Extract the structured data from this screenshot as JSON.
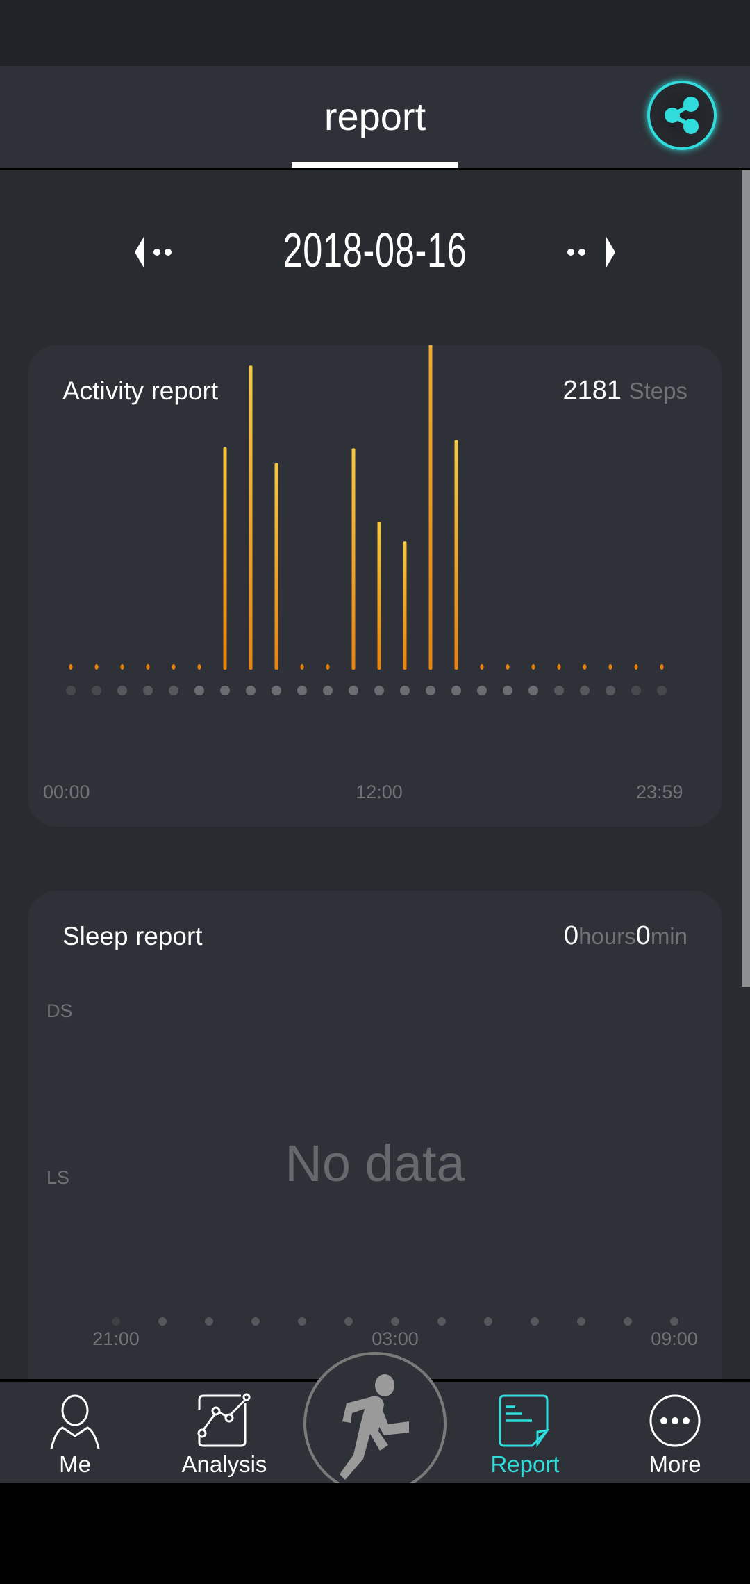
{
  "header": {
    "title": "report",
    "share_icon": "share-icon"
  },
  "date_nav": {
    "date": "2018-08-16",
    "prev_icon": "arrow-left-icon",
    "next_icon": "arrow-right-icon"
  },
  "activity": {
    "title": "Activity report",
    "steps": "2181",
    "steps_unit": "Steps",
    "x_labels": [
      "00:00",
      "12:00",
      "23:59"
    ]
  },
  "sleep": {
    "title": "Sleep report",
    "hours": "0",
    "hours_unit": "hours",
    "minutes": "0",
    "minutes_unit": "min",
    "y_labels": [
      "DS",
      "LS"
    ],
    "empty_text": "No data",
    "x_labels": [
      "21:00",
      "03:00",
      "09:00"
    ]
  },
  "nav": {
    "items": [
      {
        "label": "Me",
        "icon": "person-icon",
        "active": false
      },
      {
        "label": "Analysis",
        "icon": "chart-icon",
        "active": false
      },
      {
        "label": "Report",
        "icon": "document-icon",
        "active": true
      },
      {
        "label": "More",
        "icon": "more-icon",
        "active": false
      }
    ],
    "center_icon": "running-man-icon"
  },
  "colors": {
    "accent": "#30dcdc",
    "bar_top": "#f5c842",
    "bar_bottom": "#e8820e",
    "card": "#2e3137",
    "background": "#282b30"
  },
  "chart_data": {
    "type": "bar",
    "categories": [
      "00",
      "01",
      "02",
      "03",
      "04",
      "05",
      "06",
      "07",
      "08",
      "09",
      "10",
      "11",
      "12",
      "13",
      "14",
      "15",
      "16",
      "17",
      "18",
      "19",
      "20",
      "21",
      "22",
      "23"
    ],
    "values": [
      0,
      0,
      0,
      0,
      0,
      0,
      239,
      327,
      222,
      0,
      0,
      238,
      159,
      138,
      611,
      247,
      0,
      0,
      0,
      0,
      0,
      0,
      0,
      0
    ],
    "xlabel": "",
    "ylabel": "",
    "x_tick_labels": [
      "00:00",
      "12:00",
      "23:59"
    ],
    "grid": false
  }
}
